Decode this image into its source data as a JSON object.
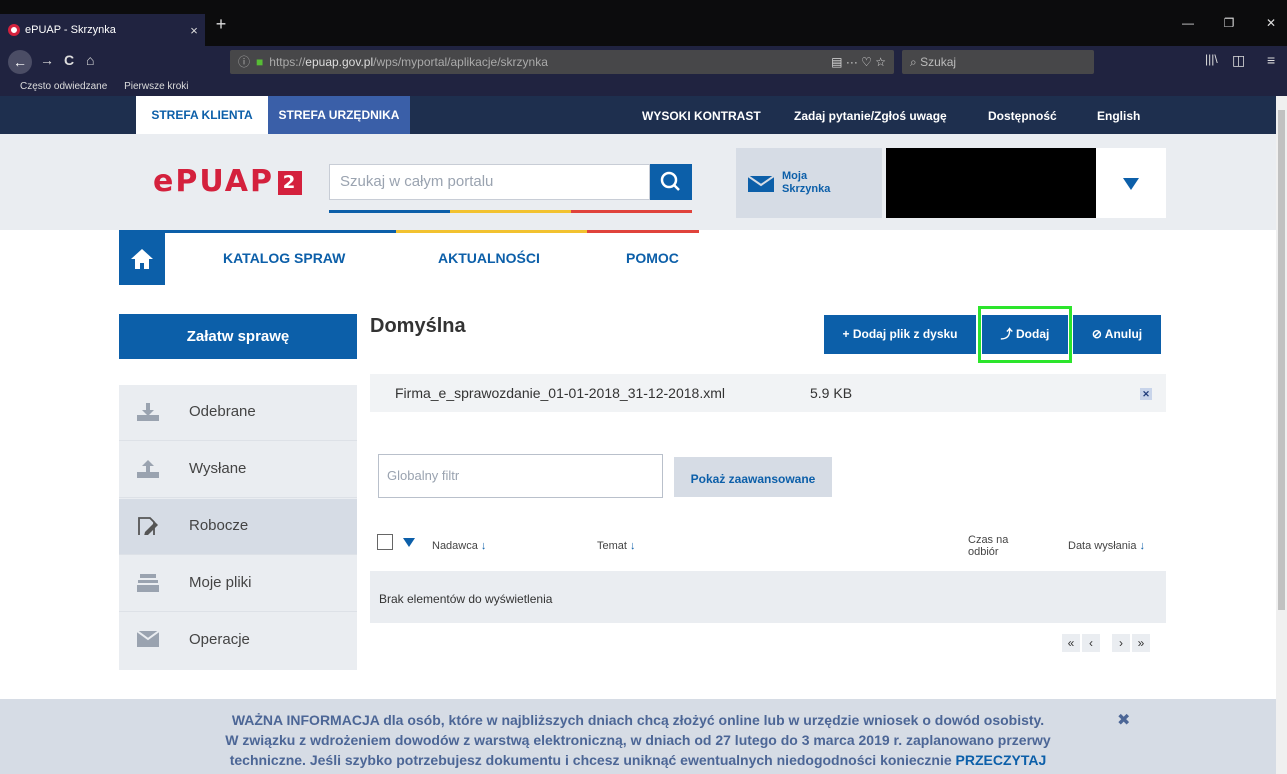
{
  "browser": {
    "tab_title": "ePUAP - Skrzynka",
    "tab_close": "×",
    "new_tab": "+",
    "url_prefix": "https://",
    "url_domain": "epuap.gov.pl",
    "url_path": "/wps/myportal/aplikacje/skrzynka",
    "url_actions": "▤   ···  ♡  ☆",
    "search_placeholder": "Szukaj",
    "bookmarks": [
      "Często odwiedzane",
      "Pierwsze kroki"
    ],
    "win_minimize": "—",
    "win_restore": "❐",
    "win_close": "✕",
    "nav_glyphs": {
      "back": "←",
      "forward": "→",
      "reload": "C",
      "home": "⌂",
      "library": "|||\\",
      "sidebar": "◫",
      "menu": "≡",
      "search": "🔍"
    }
  },
  "zones": {
    "klient": "STREFA KLIENTA",
    "urzednik": "STREFA URZĘDNIKA"
  },
  "toplinks": [
    "WYSOKI KONTRAST",
    "Zadaj pytanie/Zgłoś uwagę",
    "Dostępność",
    "English"
  ],
  "header": {
    "logo_letters": "ePUAP",
    "logo_number": "2",
    "search_placeholder": "Szukaj w całym portalu",
    "mailbox_line1": "Moja",
    "mailbox_line2": "Skrzynka"
  },
  "menu": {
    "items": [
      "KATALOG SPRAW",
      "AKTUALNOŚCI",
      "POMOC"
    ],
    "strip_colors": [
      "#0c5fa9",
      "#f2c230",
      "#e0433c"
    ]
  },
  "sidebar": {
    "action_button": "Załatw sprawę",
    "items": [
      {
        "label": "Odebrane",
        "icon": "inbox-download-icon"
      },
      {
        "label": "Wysłane",
        "icon": "outbox-upload-icon"
      },
      {
        "label": "Robocze",
        "icon": "edit-document-icon"
      },
      {
        "label": "Moje pliki",
        "icon": "files-tray-icon"
      },
      {
        "label": "Operacje",
        "icon": "envelope-icon"
      }
    ],
    "active_index": 2
  },
  "main": {
    "folder_title": "Domyślna",
    "buttons": {
      "add_from_disk": "+  Dodaj plik z dysku",
      "add": "⤴  Dodaj",
      "cancel": "⊘  Anuluj"
    },
    "file": {
      "name": "Firma_e_sprawozdanie_01-01-2018_31-12-2018.xml",
      "size": "5.9 KB",
      "remove": "✕"
    },
    "filter_placeholder": "Globalny filtr",
    "advanced_button": "Pokaż zaawansowane",
    "table": {
      "columns": {
        "sender": "Nadawca",
        "subject": "Temat",
        "time_line1": "Czas na",
        "time_line2": "odbiór",
        "sent_date": "Data wysłania"
      },
      "sort_arrow": "↓",
      "empty_message": "Brak elementów do wyświetlenia"
    },
    "pager": [
      "«",
      "‹",
      "›",
      "»"
    ]
  },
  "notice": {
    "bold_lead": "WAŻNA INFORMACJA",
    "line1_rest": " dla osób, które w najbliższych dniach chcą złożyć online lub w urzędzie wniosek o dowód osobisty.",
    "line2": "W związku z wdrożeniem dowodów z warstwą elektroniczną, w dniach od 27 lutego do 3 marca 2019 r. zaplanowano przerwy",
    "line3": "techniczne. Jeśli szybko potrzebujesz dokumentu i chcesz uniknąć ewentualnych niedogodności koniecznie ",
    "link": "PRZECZYTAJ",
    "close": "✖"
  }
}
